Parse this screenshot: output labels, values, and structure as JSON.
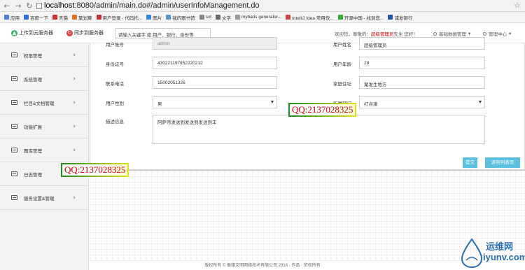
{
  "browser": {
    "url_host": "localhost",
    "url_rest": ":8080/admin/main.do#/admin/userInfoManagement.do",
    "bookmarks": [
      {
        "label": "应用",
        "color": "#4a7fd4"
      },
      {
        "label": "百度一下",
        "color": "#2f6de0"
      },
      {
        "label": "天猫",
        "color": "#d03030"
      },
      {
        "label": "聚划算",
        "color": "#e07020"
      },
      {
        "label": "用户登录 - 代码托...",
        "color": "#c03030"
      },
      {
        "label": "图片",
        "color": "#3388dd"
      },
      {
        "label": "我的图书馆",
        "color": "#5599cc"
      },
      {
        "label": "sxt",
        "color": "#888888"
      },
      {
        "label": "文字",
        "color": "#666666"
      },
      {
        "label": "mybatis generator...",
        "color": "#999999"
      },
      {
        "label": "IntelliJ Idea 常用快...",
        "color": "#cc4444"
      },
      {
        "label": "开源中国 - 找到您...",
        "color": "#33aa33"
      },
      {
        "label": "浦发银行",
        "color": "#2255aa"
      }
    ]
  },
  "header": {
    "upload_label": "上传到云服务器",
    "sync_label": "同步到服务器",
    "search_value": "请输入关键字 如:用户、银行、身份等",
    "welcome_prefix": "欢迎您，尊敬的：",
    "welcome_name": "超级管理员",
    "welcome_suffix": "先生 您好！",
    "menu_basic": "基础数据管理",
    "menu_admin": "管理中心"
  },
  "sidebar": {
    "items": [
      {
        "label": "权限管理"
      },
      {
        "label": "系统管理"
      },
      {
        "label": "栏目&文档管理"
      },
      {
        "label": "功能扩展"
      },
      {
        "label": "图库管理"
      },
      {
        "label": "日志管理"
      },
      {
        "label": "服务设置&管理"
      }
    ]
  },
  "form": {
    "username_label": "用户账号",
    "username_value": "admin",
    "name_label": "用户姓名",
    "name_value": "超级管理员",
    "idcard_label": "身份证号",
    "idcard_value": "430221197852220212",
    "age_label": "用户年龄",
    "age_value": "28",
    "phone_label": "联系电话",
    "phone_value": "15002051326",
    "address_label": "家庭住址",
    "address_value": "案发生地方",
    "gender_label": "用户性别",
    "gender_value": "男",
    "dept_label": "所属部门",
    "dept_value": "打点滴",
    "desc_label": "描述信息",
    "desc_value": "阿萨帝发送到发送到发送到丰"
  },
  "actions": {
    "submit_label": "提交",
    "back_label": "返回列表页"
  },
  "footer": {
    "text": "版权所有 © 振雄文明网络技术有限公司 2016 · 作品 · 仿权所有"
  },
  "watermarks": {
    "qq": "QQ:2137028325",
    "site_cn": "运维网",
    "site_en": "iyunv.com"
  },
  "colors": {
    "submit": "#5bc0de",
    "back": "#5bc0de",
    "upload_icon": "#3cb371",
    "sync_icon": "#e04040"
  }
}
